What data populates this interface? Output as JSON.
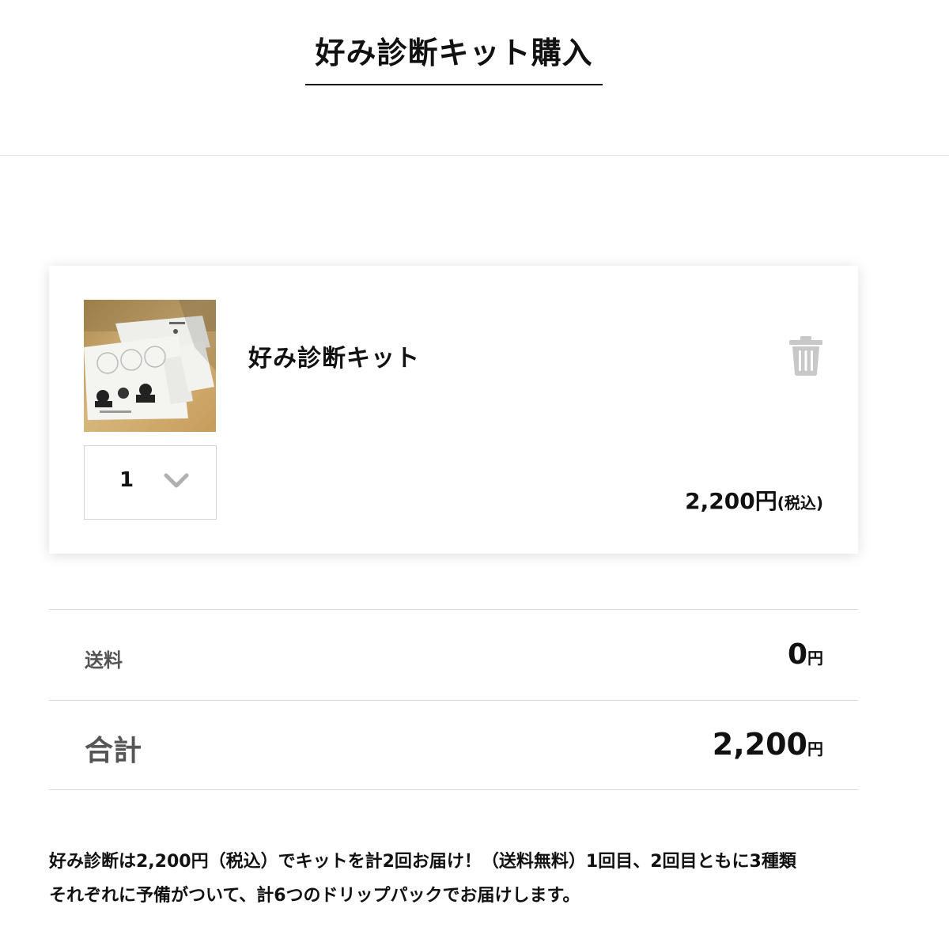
{
  "header": {
    "title": "好み診断キット購入"
  },
  "cart": {
    "item": {
      "name": "好み診断キット",
      "quantity": "1",
      "price": "2,200円",
      "price_note": "(税込)",
      "thumbnail_icon": "product-photo",
      "delete_icon": "trash-icon",
      "quantity_icon": "chevron-down-icon"
    }
  },
  "summary": {
    "shipping_label": "送料",
    "shipping_value": "0",
    "shipping_unit": "円",
    "total_label": "合計",
    "total_value": "2,200",
    "total_unit": "円"
  },
  "note": {
    "line1": "好み診断は2,200円（税込）でキットを計2回お届け！（送料無料）1回目、2回目ともに3種類",
    "line2": "それぞれに予備がついて、計6つのドリップパックでお届けします。"
  },
  "colors": {
    "text": "#111111",
    "label_gray": "#555555",
    "icon_gray": "#c8c8c8",
    "divider": "#d8d8d8"
  }
}
